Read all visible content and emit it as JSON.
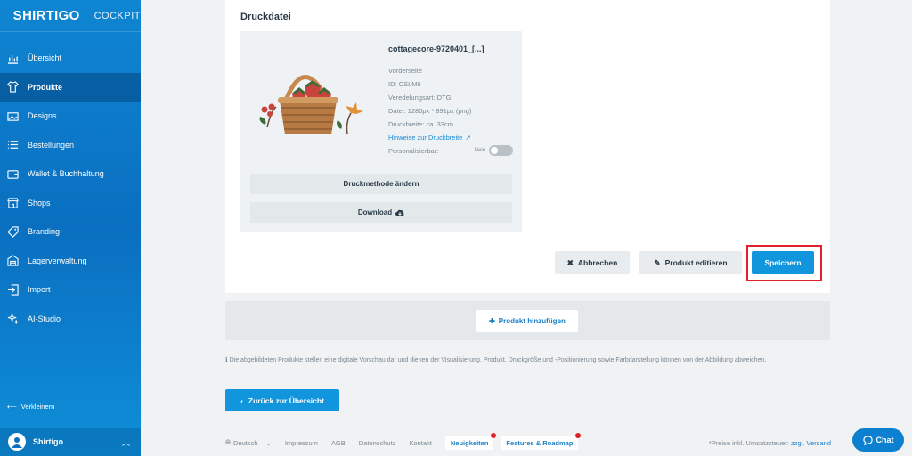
{
  "brand": {
    "name": "SHIRTIGO",
    "sub": "COCKPIT"
  },
  "sidebar": {
    "items": [
      {
        "label": "Übersicht",
        "icon": "bar-chart-icon"
      },
      {
        "label": "Produkte",
        "icon": "shirt-icon",
        "active": true
      },
      {
        "label": "Designs",
        "icon": "image-icon"
      },
      {
        "label": "Bestellungen",
        "icon": "list-icon"
      },
      {
        "label": "Wallet & Buchhaltung",
        "icon": "wallet-icon"
      },
      {
        "label": "Shops",
        "icon": "store-icon"
      },
      {
        "label": "Branding",
        "icon": "tag-icon"
      },
      {
        "label": "Lagerverwaltung",
        "icon": "warehouse-icon"
      },
      {
        "label": "Import",
        "icon": "import-icon"
      },
      {
        "label": "AI-Studio",
        "icon": "sparkle-icon"
      }
    ],
    "shrink_label": "Verkleinern",
    "user_name": "Shirtigo"
  },
  "card": {
    "title": "Druckdatei",
    "file_title": "cottagecore-9720401_[...]",
    "side": "Vorderseite",
    "id": "ID: CSLM6",
    "finishing": "Veredelungsart: DTG",
    "file": "Datei: 1280px * 891px (png)",
    "print_width": "Druckbreite: ca. 33cm",
    "hint_link": "Hinweise zur Druckbreite",
    "personalizable_label": "Personalisierbar:",
    "personalizable_value": "Nein",
    "change_method_btn": "Druckmethode ändern",
    "download_btn": "Download",
    "cancel_btn": "Abbrechen",
    "edit_btn": "Produkt editieren",
    "save_btn": "Speichern"
  },
  "add_product_btn": "Produkt hinzufügen",
  "notice": "Die abgebildeten Produkte stellen eine digitale Vorschau dar und dienen der Visualisierung. Produkt, Druckgröße und -Positionierung sowie Farbdarstellung können von der Abbildung abweichen.",
  "back_btn": "Zurück zur Übersicht",
  "footer": {
    "language": "Deutsch",
    "links": [
      "Impressum",
      "AGB",
      "Datenschutz",
      "Kontakt"
    ],
    "news": "Neuigkeiten",
    "roadmap": "Features & Roadmap",
    "price_note": "*Preise inkl. Umsatzsteuer:",
    "shipping_link": "zzgl. Versand"
  },
  "chat_label": "Chat",
  "colors": {
    "primary": "#1196de",
    "highlight": "#e0202a"
  }
}
